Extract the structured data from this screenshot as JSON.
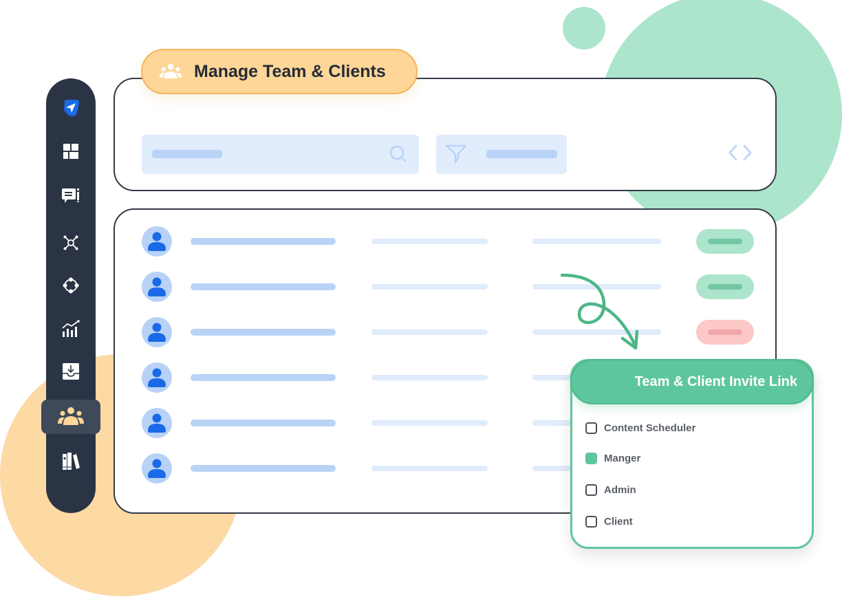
{
  "title": "Manage Team & Clients",
  "sidebar": {
    "items": [
      {
        "icon": "send-icon",
        "active": false
      },
      {
        "icon": "dashboard-icon",
        "active": false
      },
      {
        "icon": "comment-edit-icon",
        "active": false
      },
      {
        "icon": "network-icon",
        "active": false
      },
      {
        "icon": "nodes-icon",
        "active": false
      },
      {
        "icon": "analytics-icon",
        "active": false
      },
      {
        "icon": "inbox-download-icon",
        "active": false
      },
      {
        "icon": "team-icon",
        "active": true
      },
      {
        "icon": "library-icon",
        "active": false
      }
    ]
  },
  "toolbar": {
    "search_icon": "search-icon",
    "filter_icon": "filter-icon",
    "pager_icons": [
      "chevron-left-icon",
      "chevron-right-icon"
    ]
  },
  "rows": [
    {
      "status": "active"
    },
    {
      "status": "active"
    },
    {
      "status": "inactive"
    },
    {
      "status": null
    },
    {
      "status": null
    },
    {
      "status": null
    }
  ],
  "invite_card": {
    "title": "Team & Client Invite Link",
    "options": [
      {
        "label": "Content Scheduler",
        "checked": false
      },
      {
        "label": "Manger",
        "checked": true
      },
      {
        "label": "Admin",
        "checked": false
      },
      {
        "label": "Client",
        "checked": false
      }
    ]
  },
  "colors": {
    "sidebar_bg": "#2b3444",
    "accent_orange": "#fdd698",
    "accent_green": "#5ec69d",
    "status_active_bg": "#ace4cc",
    "status_active_fg": "#73c7a2",
    "status_inactive_bg": "#fdc8c8",
    "status_inactive_fg": "#f1a7a9",
    "avatar_fg": "#1a6ae8"
  }
}
